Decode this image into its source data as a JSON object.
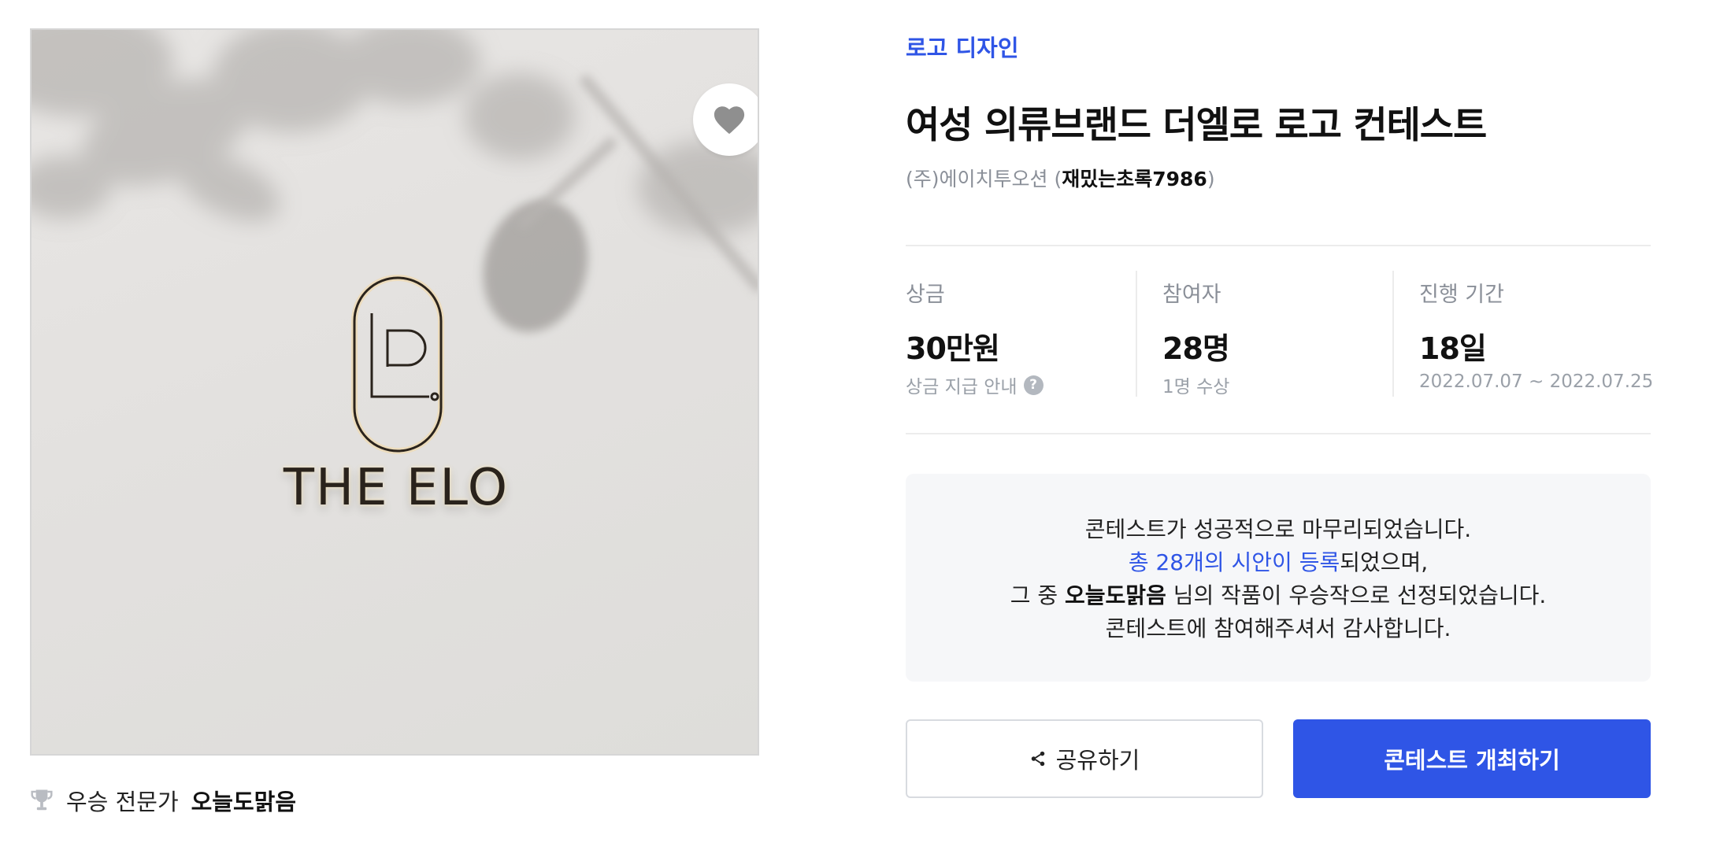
{
  "contest": {
    "category": "로고 디자인",
    "title": "여성 의류브랜드 더엘로 로고 컨테스트",
    "host_company": "(주)에이치투오션 (",
    "host_user": "재밌는초록7986",
    "host_close": ")"
  },
  "image": {
    "logo_text": "THE ELO"
  },
  "winner": {
    "label": "우승 전문가",
    "name": "오늘도맑음"
  },
  "stats": {
    "prize": {
      "label": "상금",
      "value": "30만원",
      "sub": "상금 지급 안내",
      "help": "?"
    },
    "participants": {
      "label": "참여자",
      "value": "28명",
      "sub": "1명 수상"
    },
    "period": {
      "label": "진행 기간",
      "value": "18일",
      "sub": "2022.07.07 ~ 2022.07.25"
    }
  },
  "notice": {
    "line1": "콘테스트가 성공적으로 마무리되었습니다.",
    "line2_link": "총 28개의 시안이 등록",
    "line2_rest": "되었으며,",
    "line3_pre": "그 중 ",
    "line3_name": "오늘도맑음",
    "line3_post": " 님의 작품이 우승작으로 선정되었습니다.",
    "line4": "콘테스트에 참여해주셔서 감사합니다."
  },
  "buttons": {
    "share": "공유하기",
    "host": "콘테스트 개최하기"
  },
  "colors": {
    "accent": "#2f55e6",
    "muted": "#8a8f98",
    "notice_bg": "#f6f7f9"
  },
  "icons": [
    "heart-icon",
    "trophy-icon",
    "share-icon",
    "help-icon"
  ]
}
